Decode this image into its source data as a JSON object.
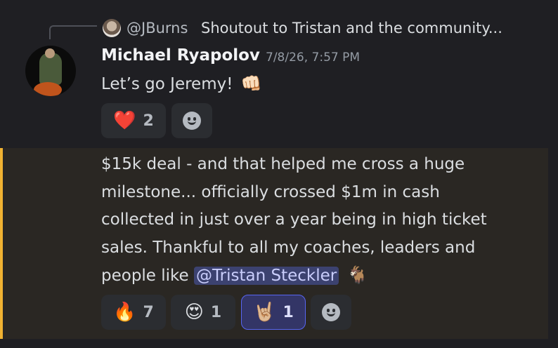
{
  "reply": {
    "username": "@JBurns",
    "preview": "Shoutout to Tristan and the community..."
  },
  "message": {
    "author": "Michael Ryapolov",
    "timestamp": "7/8/26, 7:57 PM",
    "text": "Let’s go Jeremy!",
    "text_emoji": "👊🏻",
    "reactions": [
      {
        "emoji": "❤️",
        "count": "2",
        "active": false
      }
    ],
    "add_reaction_icon": "smiley-add-reaction-icon"
  },
  "highlighted_message": {
    "lines": [
      "$15k deal - and that helped me  cross a huge",
      "milestone... officially crossed $1m in cash",
      "collected in just over a year being in high ticket",
      "sales. Thankful to all my coaches, leaders and"
    ],
    "last_line_prefix": "people like ",
    "mention": "@Tristan Steckler",
    "trailing_emoji": "🐐",
    "reactions": [
      {
        "emoji": "🔥",
        "count": "7",
        "active": false
      },
      {
        "emoji": "😍",
        "count": "1",
        "active": false
      },
      {
        "emoji": "🤘🏼",
        "count": "1",
        "active": true
      }
    ],
    "accent_color": "#f0b232"
  }
}
